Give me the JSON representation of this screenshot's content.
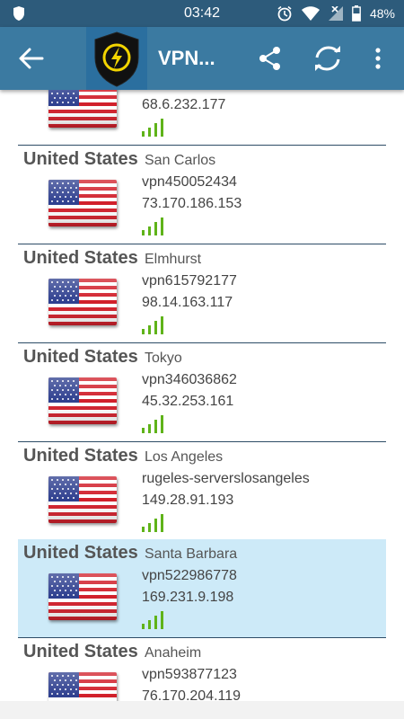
{
  "status": {
    "time": "03:42",
    "battery": "48%"
  },
  "appbar": {
    "title": "VPN..."
  },
  "icons": {
    "back": "back-arrow-icon",
    "share": "share-icon",
    "refresh": "refresh-icon",
    "menu": "overflow-menu-icon",
    "logo": "shield-lightning-icon"
  },
  "colors": {
    "statusbar": "#2d5b7b",
    "appbar": "#3b7aa1",
    "selected_row": "#cdeaf8",
    "signal": "#5fb319"
  },
  "servers": [
    {
      "country": "United States",
      "city": "",
      "host": "",
      "ip": "68.6.232.177",
      "selected": false
    },
    {
      "country": "United States",
      "city": "San Carlos",
      "host": "vpn450052434",
      "ip": "73.170.186.153",
      "selected": false
    },
    {
      "country": "United States",
      "city": "Elmhurst",
      "host": "vpn615792177",
      "ip": "98.14.163.117",
      "selected": false
    },
    {
      "country": "United States",
      "city": "Tokyo",
      "host": "vpn346036862",
      "ip": "45.32.253.161",
      "selected": false
    },
    {
      "country": "United States",
      "city": "Los Angeles",
      "host": "rugeles-serverslosangeles",
      "ip": "149.28.91.193",
      "selected": false
    },
    {
      "country": "United States",
      "city": "Santa Barbara",
      "host": "vpn522986778",
      "ip": "169.231.9.198",
      "selected": true
    },
    {
      "country": "United States",
      "city": "Anaheim",
      "host": "vpn593877123",
      "ip": "76.170.204.119",
      "selected": false
    }
  ]
}
